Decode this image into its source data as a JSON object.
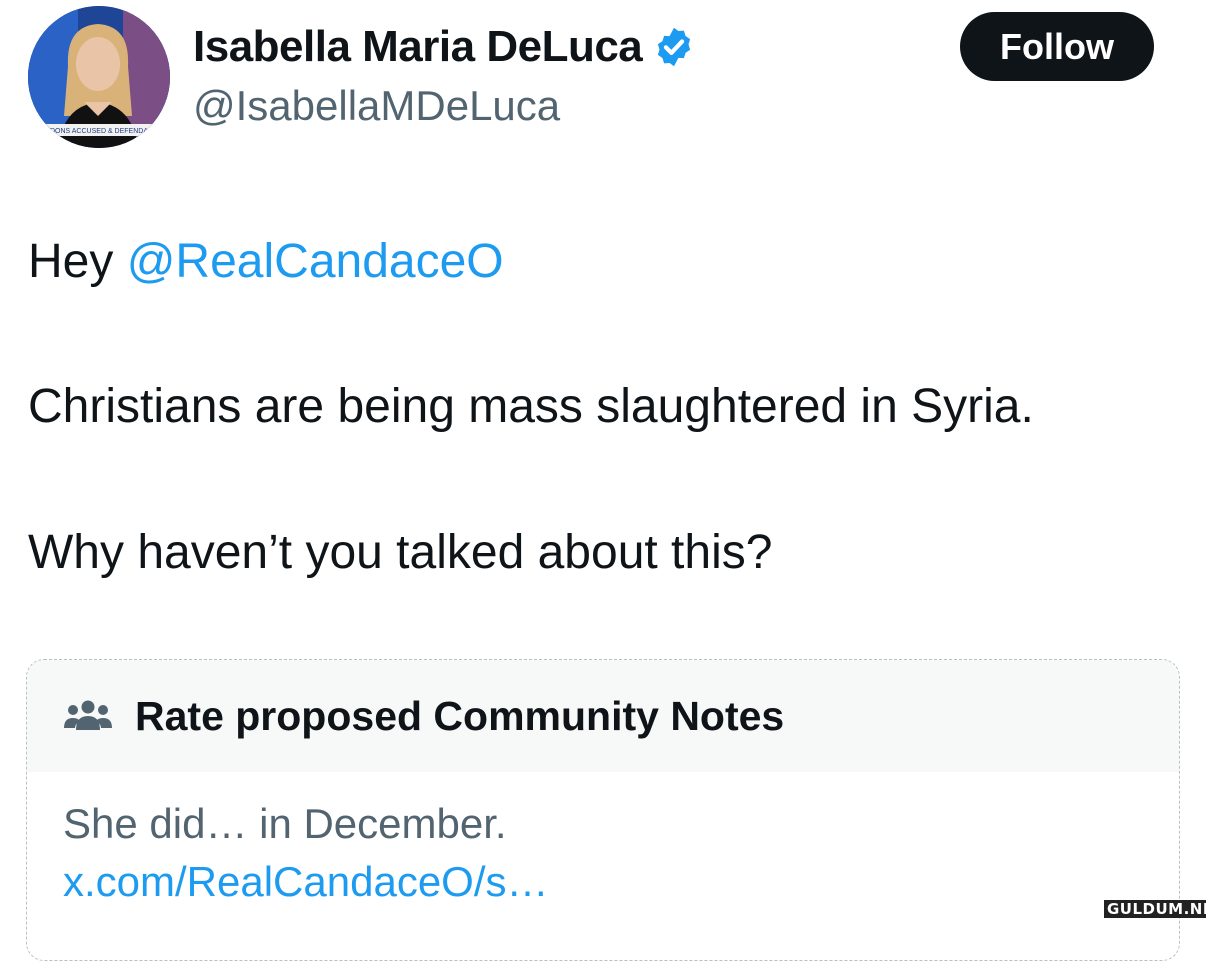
{
  "user": {
    "display_name": "Isabella Maria DeLuca",
    "handle": "@IsabellaMDeLuca",
    "verified": true,
    "avatar_ticker": "DONS ACCUSED & DEFENDA"
  },
  "follow_label": "Follow",
  "tweet": {
    "greeting": "Hey",
    "mention": "@RealCandaceO",
    "line2": "Christians are being mass slaughtered in Syria.",
    "line3": "Why haven’t you talked about this?"
  },
  "community_note": {
    "title": "Rate proposed Community Notes",
    "text": "She did… in December.",
    "link": "x.com/RealCandaceO/s…"
  },
  "watermark": "GULDUM.NET",
  "colors": {
    "accent": "#1d9bf0",
    "text": "#0f1419",
    "secondary": "#536471",
    "button": "#0f1419"
  }
}
